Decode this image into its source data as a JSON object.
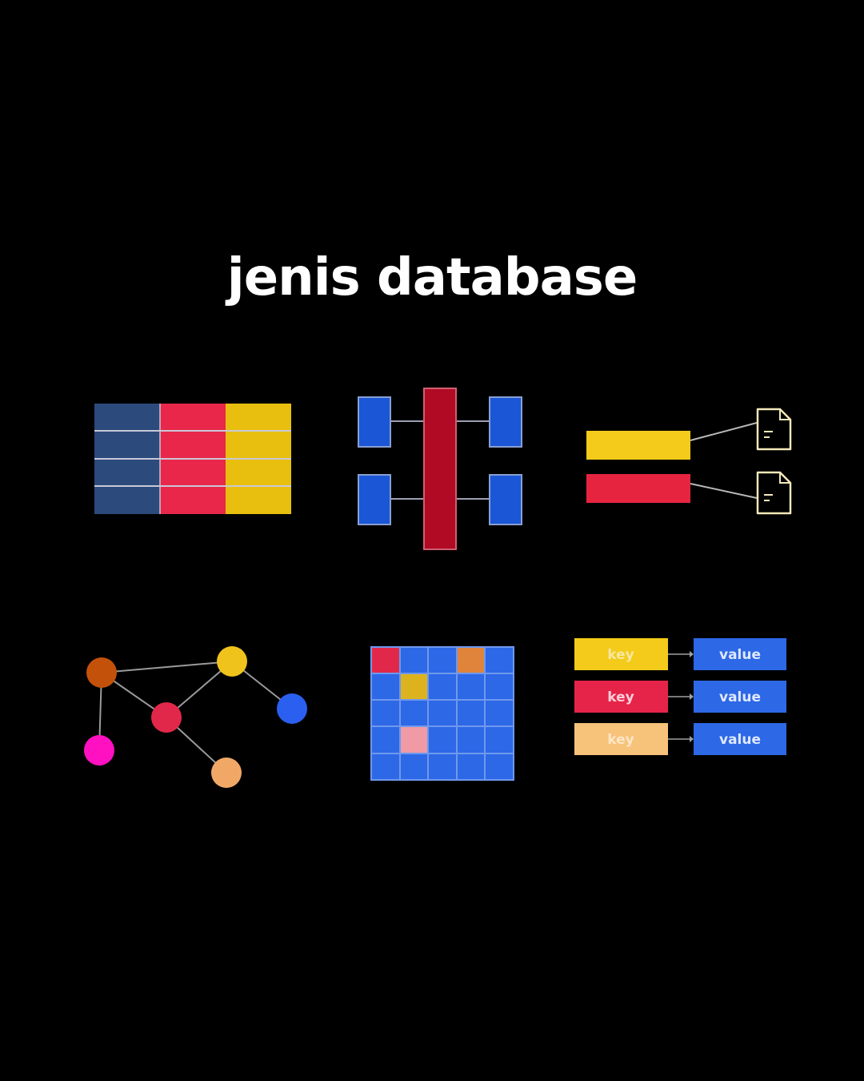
{
  "title": "jenis database",
  "colors": {
    "background": "#000000",
    "navy": "#2c4a7c",
    "crimson": "#e8274a",
    "gold": "#e8bf0e",
    "blue": "#1a56d6",
    "darkred": "#b00a24",
    "yellow": "#f4cb1a",
    "red": "#e6243f",
    "doc": "#f3e8b8",
    "peach": "#f7c27a",
    "grid_blue": "#2d68e6",
    "grid_line": "#6f99ee",
    "orange": "#c4510a",
    "magenta": "#ff10c0",
    "node_yellow": "#f0c31c",
    "node_blue": "#2b5ff0",
    "node_red": "#e2284a",
    "node_peach": "#f1a867",
    "cell_orange": "#e0843c",
    "cell_gold": "#dcb31e",
    "cell_pink": "#ef9aa5"
  },
  "icons": {
    "document": "document-icon"
  },
  "key_value": {
    "rows": [
      {
        "key": "key",
        "value": "value"
      },
      {
        "key": "key",
        "value": "value"
      },
      {
        "key": "key",
        "value": "value"
      }
    ]
  }
}
